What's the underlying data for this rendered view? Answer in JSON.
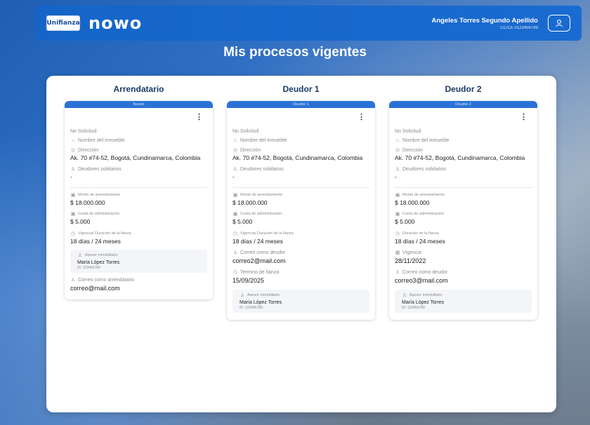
{
  "header": {
    "brand_partner": "Unifianza",
    "brand": "nowo",
    "user_name": "Angeles Torres Segundo Apellido",
    "user_id": "CC/CE 0123456789"
  },
  "page": {
    "title": "Mis procesos vigentes"
  },
  "columns": [
    {
      "title": "Arrendatario",
      "tab": "Nuevo",
      "solicitud_label": "No Solicitud",
      "inmueble_label": "Nombre del inmueble",
      "direccion_label": "Dirección",
      "direccion": "Ak. 70 #74-52, Bogotá, Cundinamarca, Colombia",
      "deudores_label": "Deudores solidarios",
      "deudores": "-",
      "canon_label": "Monto de arrendamiento",
      "canon": "$ 18.000.000",
      "cuota_label": "Cuota de administración",
      "cuota": "$ 5.000",
      "vigencia_label": "Vigencia/ Duración de la fianza",
      "vigencia": "18 días / 24 meses",
      "asesor_label": "Asesor inmobiliario",
      "asesor_name": "María López Torres",
      "asesor_id": "ID: 123456789",
      "correo_label": "Correo como arrendatario",
      "correo": "correo@mail.com"
    },
    {
      "title": "Deudor 1",
      "tab": "Deudor 1",
      "solicitud_label": "No Solicitud",
      "inmueble_label": "Nombre del inmueble",
      "direccion_label": "Dirección",
      "direccion": "Ak. 70 #74-52, Bogotá, Cundinamarca, Colombia",
      "deudores_label": "Deudores solidarios",
      "deudores": "-",
      "canon_label": "Monto de arrendamiento",
      "canon": "$ 18.000.000",
      "cuota_label": "Cuota de administración",
      "cuota": "$ 5.000",
      "vigencia_label": "Vigencia/ Duración de la fianza",
      "vigencia": "18 días / 24 meses",
      "correo_label": "Correo como deudor",
      "correo": "correo2@mail.com",
      "termino_label": "Termino de fianza",
      "termino": "15/09/2025",
      "asesor_label": "Asesor inmobiliario",
      "asesor_name": "María López Torres",
      "asesor_id": "ID: 123456789"
    },
    {
      "title": "Deudor 2",
      "tab": "Deudor 2",
      "solicitud_label": "No Solicitud",
      "inmueble_label": "Nombre del inmueble",
      "direccion_label": "Dirección",
      "direccion": "Ak. 70 #74-52, Bogotá, Cundinamarca, Colombia",
      "deudores_label": "Deudores solidarios",
      "deudores": "-",
      "canon_label": "Monto de arrendamiento",
      "canon": "$ 18.000.000",
      "cuota_label": "Cuota de administración",
      "cuota": "$ 5.000",
      "duracion_label": "Duración de la fianza",
      "duracion": "18 días / 24 meses",
      "vigencia_label": "Vigencia",
      "vigencia": "28/11/2022",
      "correo_label": "Correo como deudor",
      "correo": "correo3@mail.com",
      "asesor_label": "Asesor inmobiliario",
      "asesor_name": "María López Torres",
      "asesor_id": "ID: 123456789"
    }
  ]
}
